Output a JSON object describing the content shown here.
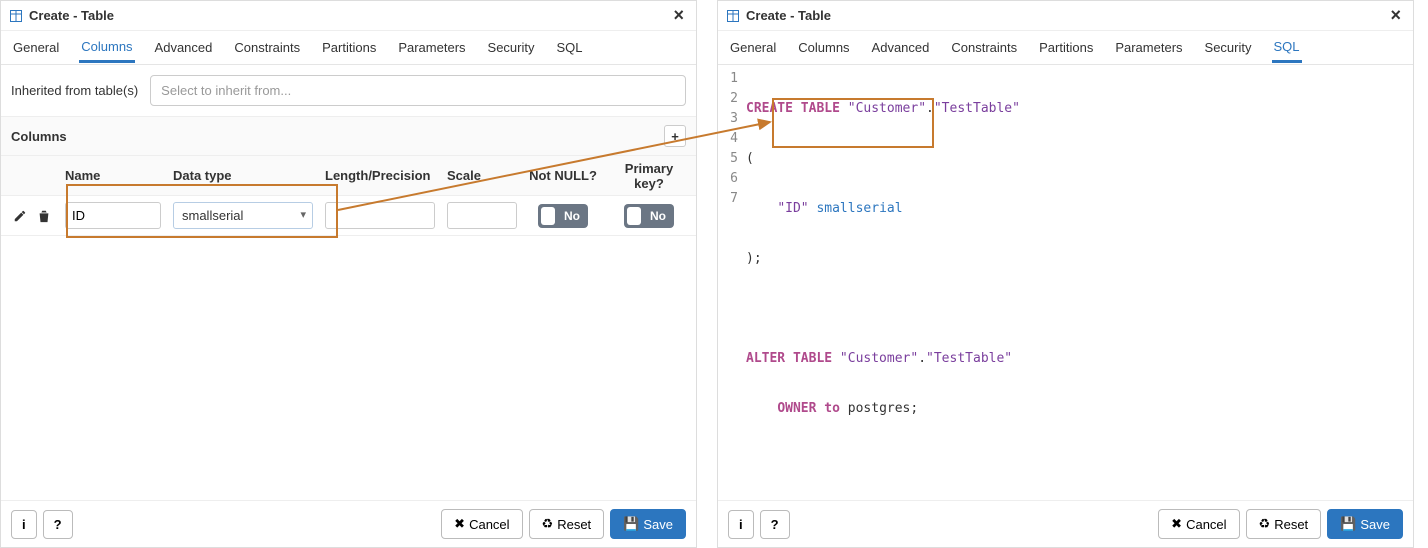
{
  "left": {
    "title": "Create - Table",
    "tabs": [
      "General",
      "Columns",
      "Advanced",
      "Constraints",
      "Partitions",
      "Parameters",
      "Security",
      "SQL"
    ],
    "active_tab": "Columns",
    "inherit_label": "Inherited from table(s)",
    "inherit_placeholder": "Select to inherit from...",
    "columns_section": "Columns",
    "headers": {
      "name": "Name",
      "type": "Data type",
      "len": "Length/Precision",
      "scale": "Scale",
      "notnull": "Not NULL?",
      "pk": "Primary key?"
    },
    "row": {
      "name": "ID",
      "type": "smallserial",
      "notnull": "No",
      "pk": "No"
    }
  },
  "right": {
    "title": "Create - Table",
    "tabs": [
      "General",
      "Columns",
      "Advanced",
      "Constraints",
      "Partitions",
      "Parameters",
      "Security",
      "SQL"
    ],
    "active_tab": "SQL",
    "sql": {
      "l1a": "CREATE TABLE ",
      "l1b": "\"Customer\"",
      "l1c": ".",
      "l1d": "\"TestTable\"",
      "l2": "(",
      "l3a": "    ",
      "l3b": "\"ID\"",
      "l3c": " ",
      "l3d": "smallserial",
      "l4": ");",
      "l5": "",
      "l6a": "ALTER TABLE ",
      "l6b": "\"Customer\"",
      "l6c": ".",
      "l6d": "\"TestTable\"",
      "l7a": "    ",
      "l7b": "OWNER to ",
      "l7c": "postgres;"
    },
    "line_numbers": [
      "1",
      "2",
      "3",
      "4",
      "5",
      "6",
      "7"
    ]
  },
  "footer": {
    "cancel": "Cancel",
    "reset": "Reset",
    "save": "Save"
  }
}
